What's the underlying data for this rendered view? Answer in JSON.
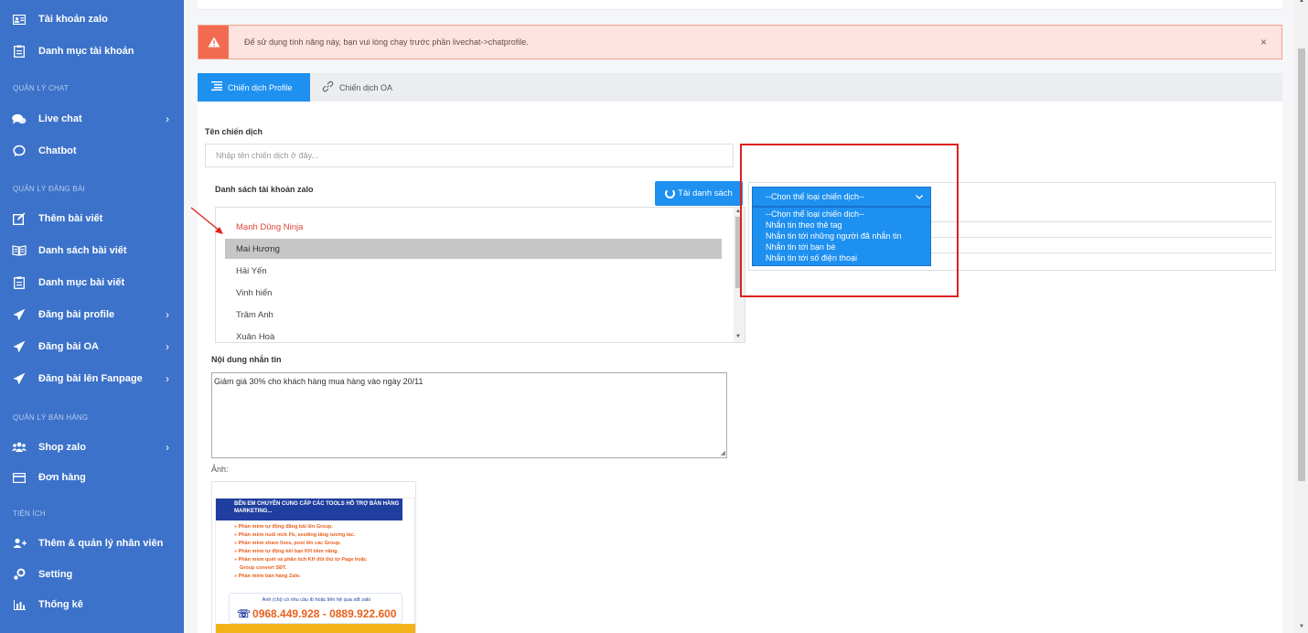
{
  "sidebar": {
    "items": [
      {
        "label": "Tài khoản zalo",
        "icon": "id-card-icon"
      },
      {
        "label": "Danh mục tài khoản",
        "icon": "clipboard-icon"
      },
      {
        "label": "Live chat",
        "icon": "chat-bubbles-icon",
        "has_submenu": true
      },
      {
        "label": "Chatbot",
        "icon": "chat-bubble-outline-icon"
      },
      {
        "label": "Thêm bài viết",
        "icon": "edit-icon"
      },
      {
        "label": "Danh sách bài viết",
        "icon": "book-icon"
      },
      {
        "label": "Danh mục bài viết",
        "icon": "clipboard-icon"
      },
      {
        "label": "Đăng bài profile",
        "icon": "send-icon",
        "has_submenu": true
      },
      {
        "label": "Đăng bài OA",
        "icon": "send-icon",
        "has_submenu": true
      },
      {
        "label": "Đăng bài lên Fanpage",
        "icon": "send-icon",
        "has_submenu": true
      },
      {
        "label": "Shop zalo",
        "icon": "users-icon",
        "has_submenu": true
      },
      {
        "label": "Đơn hàng",
        "icon": "credit-card-icon"
      },
      {
        "label": "Thêm & quản lý nhân viên",
        "icon": "user-add-icon"
      },
      {
        "label": "Setting",
        "icon": "settings-icon"
      },
      {
        "label": "Thống kê",
        "icon": "bar-chart-icon"
      }
    ],
    "sections": {
      "chat": "QUẢN LÝ CHAT",
      "post": "QUẢN LÝ ĐĂNG BÀI",
      "sales": "QUẢN LÝ BÁN HÀNG",
      "utilities": "TIỆN ÍCH"
    },
    "chevron": "›"
  },
  "alert": {
    "icon": "!",
    "text": "Để sử dụng tính năng này, bạn vui lòng chạy trước phần livechat->chatprofile.",
    "close": "×"
  },
  "tabs": [
    {
      "label": "Chiến dịch Profile",
      "icon": "list-icon",
      "active": true
    },
    {
      "label": "Chiến dịch OA",
      "icon": "link-icon",
      "active": false
    }
  ],
  "form": {
    "campaign_name_label": "Tên chiến dịch",
    "campaign_name_placeholder": "Nhập tên chiến dịch ở đây...",
    "accounts_label": "Danh sách tài khoản zalo",
    "load_button": "Tải danh sách",
    "accounts": [
      "Mạnh Dũng Ninja",
      "Mai Hương",
      "Hải Yến",
      "Vinh hiển",
      "Trâm Anh",
      "Xuân Hoà"
    ],
    "selected_account": "Mai Hương",
    "message_label": "Nội dung nhắn tin",
    "message_value": "Giảm giá 30% cho khách hàng mua hàng vào ngày 20/11",
    "image_label": "Ảnh:"
  },
  "campaign_type_select": {
    "selected": "--Chọn thể loại chiến dịch--",
    "options": [
      "--Chọn thể loại chiến dịch--",
      "Nhắn tin theo thẻ tag",
      "Nhắn tin tới những người đã nhắn tin",
      "Nhắn tin tới bạn bè",
      "Nhắn tin tới số điện thoại"
    ]
  },
  "promo_image": {
    "header": "BÊN EM CHUYÊN CUNG CẤP CÁC TOOLS HỖ TRỢ BÁN HÀNG MARKETING...",
    "features": [
      "» Phần mềm tự động đăng bài lên Group.",
      "» Phần mềm nuôi nick Fb, seeding tăng tương tác.",
      "» Phần mềm share lives, post lên các Group.",
      "» Phần mềm tự động kết bạn KH tiềm năng.",
      "» Phần mềm quét và phân tích KH đối thủ từ Page hoặc",
      "Group convert SĐT.",
      "» Phần mềm bán hàng Zalo."
    ],
    "contact_note": "Anh (chị) có nhu cầu ib hoặc liên hệ qua sđt zalo",
    "phones": "0968.449.928 - 0889.922.600"
  },
  "colors": {
    "sidebar_bg": "#3c72c9",
    "primary": "#1e90f0",
    "alert_bg": "#fde4e0",
    "alert_icon": "#f26b50",
    "highlight_red": "#e02020"
  }
}
